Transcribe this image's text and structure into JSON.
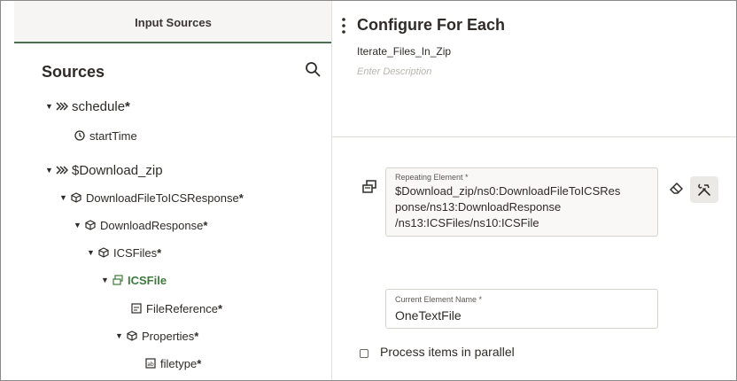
{
  "left_panel": {
    "tab_label": "Input Sources",
    "sources_title": "Sources",
    "tree": [
      {
        "label": "schedule",
        "required": "*",
        "icon": "message-icon",
        "caret": "▼"
      },
      {
        "label": "startTime",
        "required": "",
        "icon": "clock-icon",
        "caret": ""
      },
      {
        "label": "$Download_zip",
        "required": "",
        "icon": "message-icon",
        "caret": "▼"
      },
      {
        "label": "DownloadFileToICSResponse",
        "required": "*",
        "icon": "complex-type-icon",
        "caret": "▼"
      },
      {
        "label": "DownloadResponse",
        "required": "*",
        "icon": "complex-type-icon",
        "caret": "▼"
      },
      {
        "label": "ICSFiles",
        "required": "*",
        "icon": "complex-type-icon",
        "caret": "▼"
      },
      {
        "label": "ICSFile",
        "required": "",
        "icon": "repeating-element-icon",
        "caret": "▼"
      },
      {
        "label": "FileReference",
        "required": "*",
        "icon": "base64-icon",
        "caret": ""
      },
      {
        "label": "Properties",
        "required": "*",
        "icon": "complex-type-icon",
        "caret": "▼"
      },
      {
        "label": "filetype",
        "required": "*",
        "icon": "string-icon",
        "caret": ""
      }
    ]
  },
  "right_panel": {
    "title": "Configure For Each",
    "name": "Iterate_Files_In_Zip",
    "description_placeholder": "Enter Description",
    "repeating_element": {
      "label": "Repeating Element *",
      "value_lines": [
        "$Download_zip/ns0:DownloadFileToICSRes",
        "ponse/ns13:DownloadResponse",
        "/ns13:ICSFiles/ns10:ICSFile"
      ]
    },
    "current_element": {
      "label": "Current Element Name *",
      "value": "OneTextFile"
    },
    "parallel_label": "Process items in parallel",
    "parallel_checked": false
  },
  "colors": {
    "accent_green": "#3f7a3c",
    "tab_underline": "#4a6f52",
    "text": "#2f2b28"
  }
}
